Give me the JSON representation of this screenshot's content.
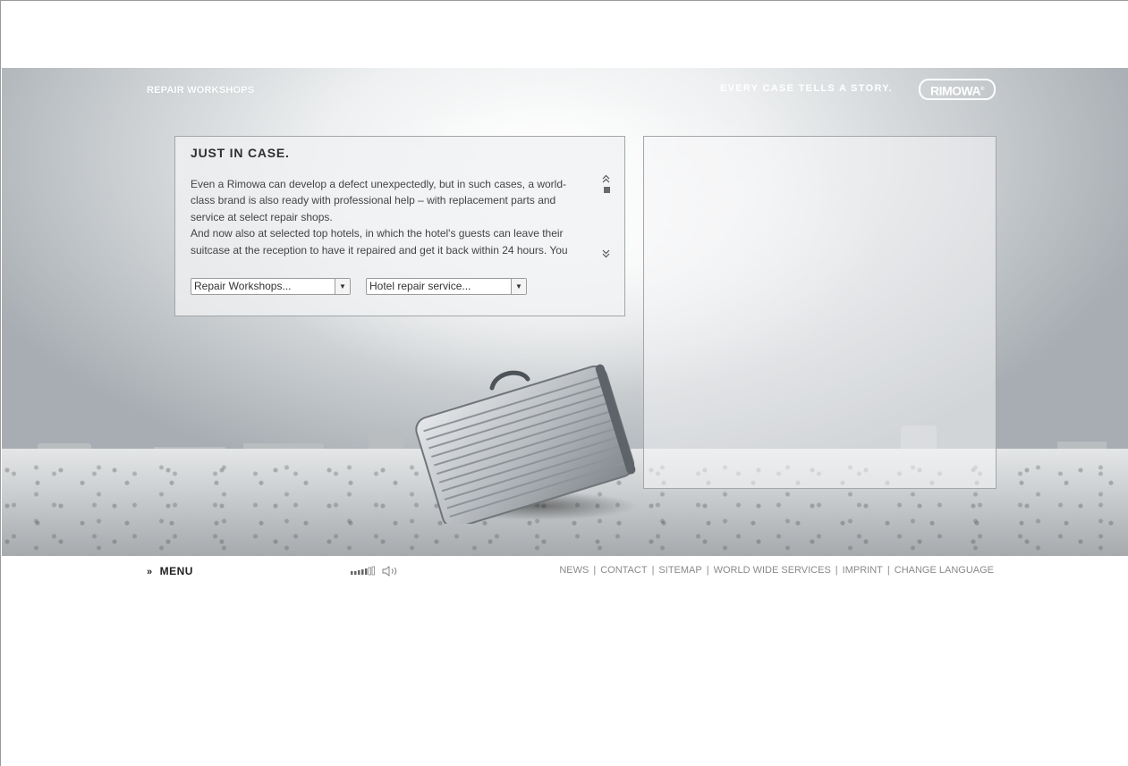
{
  "header": {
    "section_title": "REPAIR WORKSHOPS",
    "tagline": "EVERY CASE TELLS A STORY.",
    "logo": "RIMOWA"
  },
  "panel": {
    "title": "JUST IN CASE.",
    "paragraphs": [
      "Even a Rimowa can develop a defect unexpectedly, but in such cases, a world-class brand is also ready with professional help – with replacement parts and service at select repair shops.",
      "And now also at selected top hotels, in which the hotel's guests can leave their suitcase at the reception to have it repaired and get it back within 24 hours. You"
    ],
    "select_workshops": "Repair Workshops...",
    "select_hotels": "Hotel repair service...",
    "scroll_up_glyph": "⌃⌃",
    "scroll_down_glyph": "⌄⌄"
  },
  "footer": {
    "menu_chevron": "»",
    "menu_label": "MENU",
    "links": [
      "NEWS",
      "CONTACT",
      "SITEMAP",
      "WORLD WIDE SERVICES",
      "IMPRINT",
      "CHANGE LANGUAGE"
    ],
    "separator": "|"
  },
  "colors": {
    "panel_border": "#a3a7aa",
    "link_gray": "#8a8a8a",
    "title_dark": "#2f2f2f"
  }
}
